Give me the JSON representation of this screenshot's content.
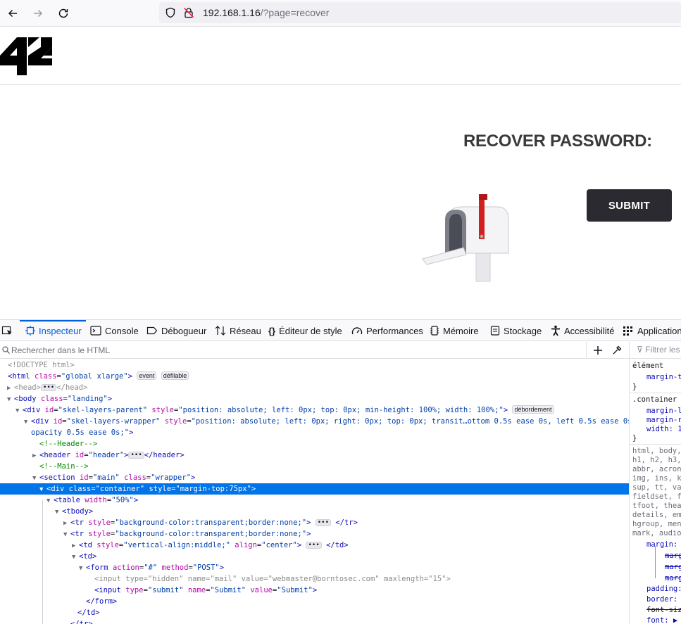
{
  "browser": {
    "url_host": "192.168.1.16",
    "url_path": "/?page=recover"
  },
  "page": {
    "logo_text": "42",
    "title": "RECOVER PASSWORD:",
    "submit_label": "SUBMIT"
  },
  "devtools": {
    "tabs": [
      {
        "label": "Inspecteur",
        "icon": "inspector-icon"
      },
      {
        "label": "Console",
        "icon": "console-icon"
      },
      {
        "label": "Débogueur",
        "icon": "debugger-icon"
      },
      {
        "label": "Réseau",
        "icon": "network-icon"
      },
      {
        "label": "Éditeur de style",
        "icon": "style-editor-icon"
      },
      {
        "label": "Performances",
        "icon": "performance-icon"
      },
      {
        "label": "Mémoire",
        "icon": "memory-icon"
      },
      {
        "label": "Stockage",
        "icon": "storage-icon"
      },
      {
        "label": "Accessibilité",
        "icon": "accessibility-icon"
      },
      {
        "label": "Application",
        "icon": "application-icon"
      }
    ],
    "search_placeholder": "Rechercher dans le HTML",
    "rules_filter_placeholder": "Filtrer les",
    "badges": {
      "event": "event",
      "scroll": "défilable",
      "overflow": "débordement"
    },
    "tree": {
      "doctype": "<!DOCTYPE html>",
      "html_class": "global xlarge",
      "body_class": "landing",
      "skel_parent_style": "position: absolute; left: 0px; top: 0px; min-height: 100%; width: 100%;",
      "skel_wrapper_style_1": "position: absolute; left: 0px; right: 0px; top: 0px; transit…ottom 0.5s ease 0s, left 0.5s ease 0s,",
      "skel_wrapper_style_2": "opacity 0.5s ease 0s;",
      "comment_header": "<!--Header-->",
      "comment_main": "<!--Main-->",
      "section_id": "main",
      "section_class": "wrapper",
      "container_class": "container",
      "container_style": "margin-top:75px",
      "table_width": "50%",
      "tr_style": "background-color:transparent;border:none;",
      "td_style": "vertical-align:middle;",
      "td_align": "center",
      "form_action": "#",
      "form_method": "POST",
      "input1_type": "hidden",
      "input1_name": "mail",
      "input1_value": "webmaster@borntosec.com",
      "input1_maxlength": "15",
      "input2_type": "submit",
      "input2_name": "Submit",
      "input2_value": "Submit"
    },
    "rules": [
      "élément",
      "margin-to",
      "}",
      ".container",
      "margin-l",
      "margin-r",
      "width: 1",
      "}",
      "html, body,",
      "h1, h2, h3,",
      "abbr, acrony",
      "img, ins, kb",
      "sup, tt, var",
      "fieldset, fo",
      "tfoot, thead",
      "details, emb",
      "hgroup, menu",
      "mark, audio,",
      "margin: 0",
      "margi",
      "margi",
      "margi",
      "padding:",
      "border: 0",
      "font-siz",
      "font: ▶ i"
    ]
  }
}
